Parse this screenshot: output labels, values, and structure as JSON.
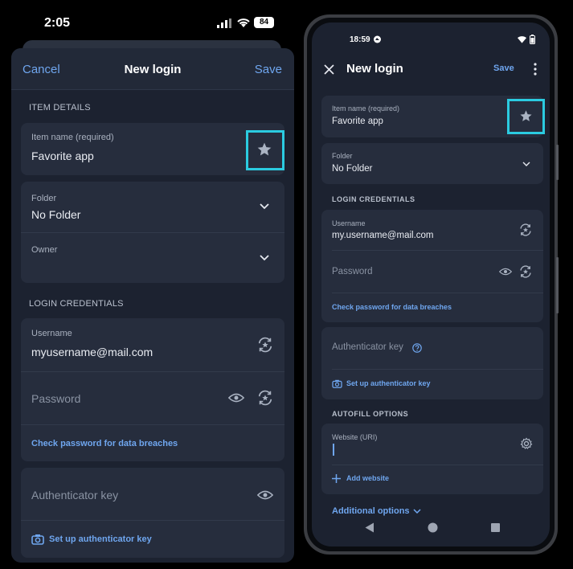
{
  "ios": {
    "status": {
      "time": "2:05",
      "battery": "84"
    },
    "nav": {
      "cancel": "Cancel",
      "title": "New login",
      "save": "Save"
    },
    "item_details": {
      "header": "ITEM DETAILS",
      "item_name_label": "Item name (required)",
      "item_name_value": "Favorite app",
      "folder_label": "Folder",
      "folder_value": "No Folder",
      "owner_label": "Owner"
    },
    "login": {
      "header": "LOGIN CREDENTIALS",
      "username_label": "Username",
      "username_value": "myusername@mail.com",
      "password_placeholder": "Password",
      "check_breaches": "Check password for data breaches"
    },
    "auth": {
      "key_placeholder": "Authenticator key",
      "setup": "Set up authenticator key"
    }
  },
  "android": {
    "status": {
      "time": "18:59"
    },
    "top": {
      "title": "New login",
      "save": "Save"
    },
    "item_name_label": "Item name (required)",
    "item_name_value": "Favorite app",
    "folder_label": "Folder",
    "folder_value": "No Folder",
    "login": {
      "header": "LOGIN CREDENTIALS",
      "username_label": "Username",
      "username_value": "my.username@mail.com",
      "password_placeholder": "Password",
      "check_breaches": "Check password for data breaches"
    },
    "auth": {
      "key_placeholder": "Authenticator key",
      "setup": "Set up authenticator key"
    },
    "autofill": {
      "header": "AUTOFILL OPTIONS",
      "website_label": "Website (URI)",
      "add_website": "Add website"
    },
    "additional_options": "Additional options"
  },
  "colors": {
    "accent": "#6fa6ef",
    "highlight": "#2bcbe0",
    "card": "#262d3d",
    "background": "#1c2230"
  }
}
